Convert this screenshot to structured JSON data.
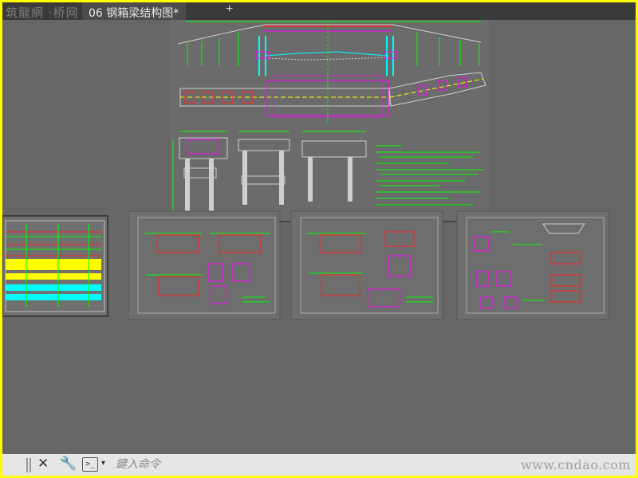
{
  "tabbar": {
    "watermark": "筑龍網 ·桥网",
    "active_tab_title": "06 钢箱梁结构图*",
    "add_tab_label": "+"
  },
  "command_line": {
    "close_label": "✕",
    "tools_label": "🔧",
    "prompt_label": ">_",
    "dropdown_label": "▾",
    "input_placeholder": "鍵入命令",
    "input_value": ""
  },
  "watermark": {
    "site": "www.cndao.com"
  },
  "colors": {
    "background": "#666666",
    "frame": "#ffff00",
    "green": "#00ff00",
    "magenta": "#ff00ff",
    "cyan": "#00ffff",
    "yellow": "#ffff00",
    "red": "#ff0000"
  }
}
